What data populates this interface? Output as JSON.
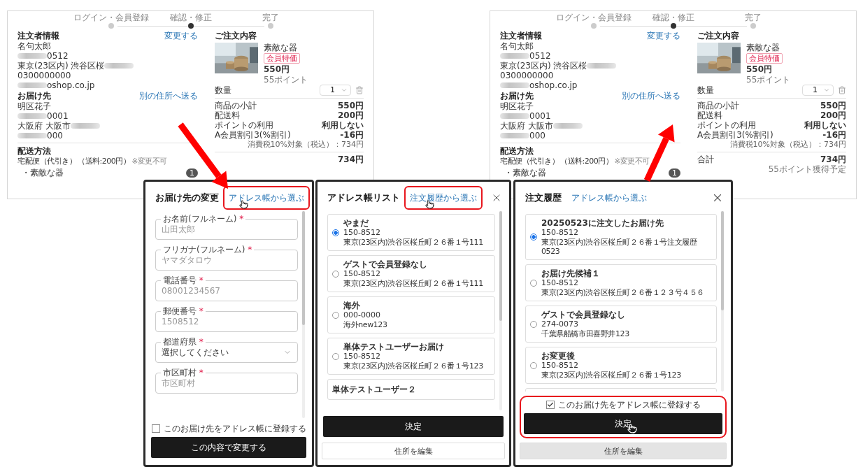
{
  "pages": [
    {
      "steps": [
        {
          "label": "ログイン・会員登録",
          "selected": false
        },
        {
          "label": "確認・修正",
          "selected": true
        },
        {
          "label": "完了",
          "selected": false
        }
      ],
      "orderer": {
        "title": "注文者情報",
        "link": "変更する",
        "lines": [
          {
            "text": "名句太郎"
          },
          {
            "text": "0512",
            "blur_before": true
          },
          {
            "text": "東京(23区内) 渋谷区桜",
            "blur_after": true
          },
          {
            "text": "0300000000"
          },
          {
            "text": "oshop.co.jp",
            "blur_before": true
          }
        ]
      },
      "recipient": {
        "title": "お届け先",
        "link": "別の住所へ送る",
        "lines": [
          {
            "text": "明区花子"
          },
          {
            "text": "0001",
            "blur_before": true
          },
          {
            "text": "大阪府 大阪市",
            "blur_after": true
          },
          {
            "text": "000",
            "blur_before": true
          }
        ]
      },
      "delivery": {
        "title": "配送方法",
        "method": "宅配便（代引き）",
        "fee": "（送料:200円）",
        "note": "※変更不可",
        "item": "・素敵な器",
        "count": "1"
      },
      "order": {
        "title": "ご注文内容",
        "name": "素敵な器",
        "tag": "会員特価",
        "price": "550円",
        "points": "55ポイント",
        "qty_label": "数量",
        "qty": "1"
      },
      "summary": [
        {
          "label": "商品の小計",
          "value": "550円"
        },
        {
          "label": "配送料",
          "value": "200円"
        },
        {
          "label": "ポイントの利用",
          "value": "利用しない"
        },
        {
          "label": "A会員割引3(%割引)",
          "value": "-16円"
        }
      ],
      "tax_note": "消費税10%対象（税込）：734円",
      "total": {
        "value": "734円"
      }
    },
    {
      "steps": [
        {
          "label": "ログイン・会員登録",
          "selected": false
        },
        {
          "label": "確認・修正",
          "selected": true
        },
        {
          "label": "完了",
          "selected": false
        }
      ],
      "orderer": {
        "title": "注文者情報",
        "link": "変更する",
        "lines": [
          {
            "text": "名句太郎"
          },
          {
            "text": "0512",
            "blur_before": true
          },
          {
            "text": "東京(23区内) 渋谷区桜",
            "blur_after": true
          },
          {
            "text": "0300000000"
          },
          {
            "text": "oshop.co.jp",
            "blur_before": true
          }
        ]
      },
      "recipient": {
        "title": "お届け先",
        "link": "別の住所へ送る",
        "lines": [
          {
            "text": "明区花子"
          },
          {
            "text": "0001",
            "blur_before": true
          },
          {
            "text": "大阪府 大阪市",
            "blur_after": true
          },
          {
            "text": "000",
            "blur_before": true
          }
        ]
      },
      "delivery": {
        "title": "配送方法",
        "method": "宅配便（代引き）",
        "fee": "（送料:200円）",
        "note": "※変更不可",
        "item": "・素敵な器",
        "count": "1"
      },
      "order": {
        "title": "ご注文内容",
        "name": "素敵な器",
        "tag": "会員特価",
        "price": "550円",
        "points": "55ポイント",
        "qty_label": "数量",
        "qty": "1"
      },
      "summary": [
        {
          "label": "商品の小計",
          "value": "550円"
        },
        {
          "label": "配送料",
          "value": "200円"
        },
        {
          "label": "ポイントの利用",
          "value": "利用しない"
        },
        {
          "label": "A会員割引3(%割引)",
          "value": "-16円"
        }
      ],
      "tax_note": "消費税10%対象（税込）：734円",
      "total": {
        "label": "合計",
        "value": "734円",
        "note": "55ポイント獲得予定"
      }
    }
  ],
  "modals": [
    {
      "kind": "form",
      "title": "お届け先の変更",
      "link": {
        "label": "アドレス帳から選ぶ",
        "highlighted": true,
        "pointer": true
      },
      "fields": [
        {
          "kind": "input",
          "label": "お名前(フルネーム)",
          "required_mark": "*",
          "placeholder": "山田太郎"
        },
        {
          "kind": "input",
          "label": "フリガナ(フルネーム)",
          "required_mark": "*",
          "placeholder": "ヤマダタロウ"
        },
        {
          "kind": "input",
          "label": "電話番号",
          "required_mark": "*",
          "placeholder": "08001234567"
        },
        {
          "kind": "input",
          "label": "郵便番号",
          "required_mark": "*",
          "placeholder": "1508512"
        },
        {
          "kind": "select",
          "label": "都道府県",
          "required_mark": "*",
          "value": "選択してください"
        },
        {
          "kind": "input",
          "label": "市区町村",
          "required_mark": "*",
          "placeholder": "市区町村"
        }
      ],
      "register": {
        "label": "このお届け先をアドレス帳に登録する",
        "checked": false
      },
      "footer_highlighted": false,
      "primary": {
        "label": "この内容で変更する",
        "pointer": false
      }
    },
    {
      "kind": "list",
      "title": "アドレス帳リスト",
      "link": {
        "label": "注文履歴から選ぶ",
        "highlighted": true,
        "pointer": true
      },
      "addresses": [
        {
          "kind": "full",
          "name": "やまだ",
          "zip": "150-8512",
          "address": "東京(23区内)渋谷区桜丘町２６番１号111",
          "selected": true
        },
        {
          "kind": "full",
          "name": "ゲストで会員登録なし",
          "zip": "150-8512",
          "address": "東京(23区内)渋谷区桜丘町２６番１号111",
          "selected": false
        },
        {
          "kind": "full",
          "name": "海外",
          "zip": "000-0000",
          "address": "海外new123",
          "selected": false
        },
        {
          "kind": "full",
          "name": "単体テストユーザーお届け",
          "zip": "150-8512",
          "address": "東京(23区内)渋谷区桜丘町２６番１号123",
          "selected": false
        },
        {
          "kind": "cut",
          "name": "単体テストユーザー２"
        }
      ],
      "footer_highlighted": false,
      "primary": {
        "label": "決定",
        "pointer": false
      },
      "secondary": {
        "label": "住所を編集",
        "shaded": false
      }
    },
    {
      "kind": "list",
      "title": "注文履歴",
      "link": {
        "label": "アドレス帳から選ぶ",
        "highlighted": false,
        "pointer": false
      },
      "addresses": [
        {
          "kind": "full",
          "name": "20250523に注文したお届け先",
          "zip": "150-8512",
          "address": "東京(23区内)渋谷区桜丘町２６番１号注文履歴0523",
          "selected": true
        },
        {
          "kind": "full",
          "name": "お届け先候補１",
          "zip": "150-8512",
          "address": "東京(23区内)渋谷区桜丘町２６番１２３号４５６",
          "selected": false
        },
        {
          "kind": "full",
          "name": "ゲストで会員登録なし",
          "zip": "274-0073",
          "address": "千葉県船橋市田喜野井123",
          "selected": false
        },
        {
          "kind": "full",
          "name": "お変更後",
          "zip": "150-8512",
          "address": "東京(23区内)渋谷区桜丘町２６番１号123",
          "selected": false
        },
        {
          "kind": "cut"
        }
      ],
      "register": {
        "label": "このお届け先をアドレス帳に登録する",
        "checked": true
      },
      "footer_highlighted": true,
      "primary": {
        "label": "決定",
        "pointer": true
      },
      "secondary": {
        "label": "住所を編集",
        "shaded": true
      }
    }
  ]
}
